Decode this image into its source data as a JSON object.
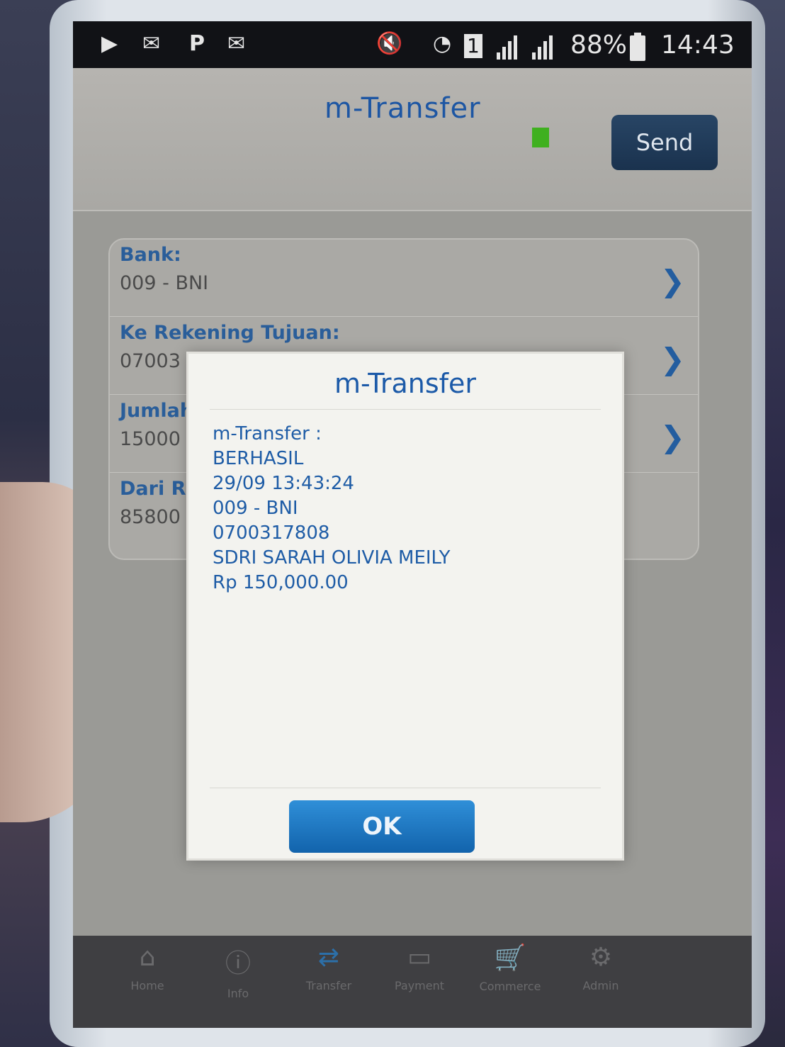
{
  "status_bar": {
    "battery": "88%",
    "time": "14:43",
    "sim_slot": "1",
    "icons": [
      "youtube-icon",
      "mail-at-icon",
      "p-icon",
      "mail-icon",
      "mute-icon",
      "wifi-icon",
      "sim-icon",
      "signal-icon",
      "battery-icon"
    ]
  },
  "header": {
    "title": "m-Transfer",
    "send_label": "Send",
    "status_color": "#3fb01f"
  },
  "form": {
    "rows": [
      {
        "label": "Bank:",
        "value": "009 - BNI"
      },
      {
        "label": "Ke Rekening Tujuan:",
        "value": "07003"
      },
      {
        "label": "Jumlah",
        "value": "15000"
      },
      {
        "label": "Dari R",
        "value": "85800"
      }
    ]
  },
  "dialog": {
    "title": "m-Transfer",
    "lines": [
      "m-Transfer :",
      "BERHASIL",
      "29/09 13:43:24",
      "009 - BNI",
      "0700317808",
      "SDRI SARAH OLIVIA MEILY",
      "Rp 150,000.00"
    ],
    "ok_label": "OK"
  },
  "bottom_nav": {
    "items": [
      {
        "label": "Home",
        "icon": "home-icon"
      },
      {
        "label": "Info",
        "icon": "info-icon"
      },
      {
        "label": "Transfer",
        "icon": "transfer-icon"
      },
      {
        "label": "Payment",
        "icon": "payment-icon"
      },
      {
        "label": "Commerce",
        "icon": "commerce-icon"
      },
      {
        "label": "Admin",
        "icon": "admin-icon"
      }
    ]
  },
  "colors": {
    "accent": "#1c5aa8",
    "ok_button": "#1f78c4",
    "send_button": "#223d5c"
  }
}
